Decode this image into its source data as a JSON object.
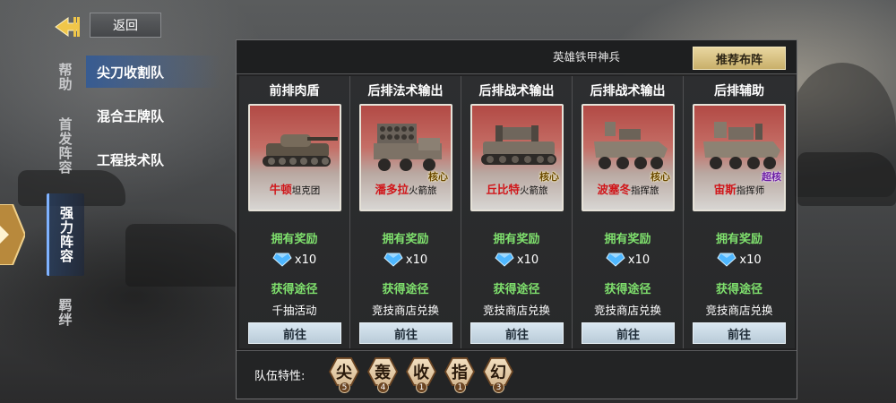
{
  "nav": {
    "back_label": "返回",
    "side_tabs": [
      {
        "label": "帮助",
        "active": false
      },
      {
        "label": "首发阵容",
        "active": false
      },
      {
        "label": "强力阵容",
        "active": true
      },
      {
        "label": "羁绊",
        "active": false
      }
    ],
    "sub_items": [
      {
        "label": "尖刀收割队",
        "active": true
      },
      {
        "label": "混合王牌队",
        "active": false
      },
      {
        "label": "工程技术队",
        "active": false
      }
    ]
  },
  "panel": {
    "title": "英雄铁甲神兵",
    "recommend_label": "推荐布阵",
    "cards": [
      {
        "role": "前排肉盾",
        "name": "牛顿",
        "type": "坦克团",
        "badge": "",
        "reward_label": "拥有奖励",
        "reward_value": "x10",
        "source_label": "获得途径",
        "source_value": "千抽活动",
        "go_label": "前往",
        "icon": "tank-icon"
      },
      {
        "role": "后排法术输出",
        "name": "潘多拉",
        "type": "火箭旅",
        "badge": "核心",
        "reward_label": "拥有奖励",
        "reward_value": "x10",
        "source_label": "获得途径",
        "source_value": "竞技商店兑换",
        "go_label": "前往",
        "icon": "rocket-launcher-icon"
      },
      {
        "role": "后排战术输出",
        "name": "丘比特",
        "type": "火箭旅",
        "badge": "核心",
        "reward_label": "拥有奖励",
        "reward_value": "x10",
        "source_label": "获得途径",
        "source_value": "竞技商店兑换",
        "go_label": "前往",
        "icon": "missile-vehicle-icon"
      },
      {
        "role": "后排战术输出",
        "name": "波塞冬",
        "type": "指挥旅",
        "badge": "核心",
        "reward_label": "拥有奖励",
        "reward_value": "x10",
        "source_label": "获得途径",
        "source_value": "竞技商店兑换",
        "go_label": "前往",
        "icon": "armored-vehicle-icon"
      },
      {
        "role": "后排辅助",
        "name": "宙斯",
        "type": "指挥师",
        "badge": "超核",
        "reward_label": "拥有奖励",
        "reward_value": "x10",
        "source_label": "获得途径",
        "source_value": "竞技商店兑换",
        "go_label": "前往",
        "icon": "command-vehicle-icon"
      }
    ],
    "traits_label": "队伍特性:",
    "traits": [
      {
        "char": "尖",
        "count": "5"
      },
      {
        "char": "轰",
        "count": "4"
      },
      {
        "char": "收",
        "count": "1"
      },
      {
        "char": "指",
        "count": "1"
      },
      {
        "char": "幻",
        "count": "3"
      }
    ]
  },
  "colors": {
    "reward_green": "#7fe06d",
    "name_red": "#d0161a",
    "recommend_gold": "#e8d6a0",
    "go_button": "#c9d9e4",
    "trait_brown": "#6b4523",
    "active_blue": "#325a96"
  }
}
